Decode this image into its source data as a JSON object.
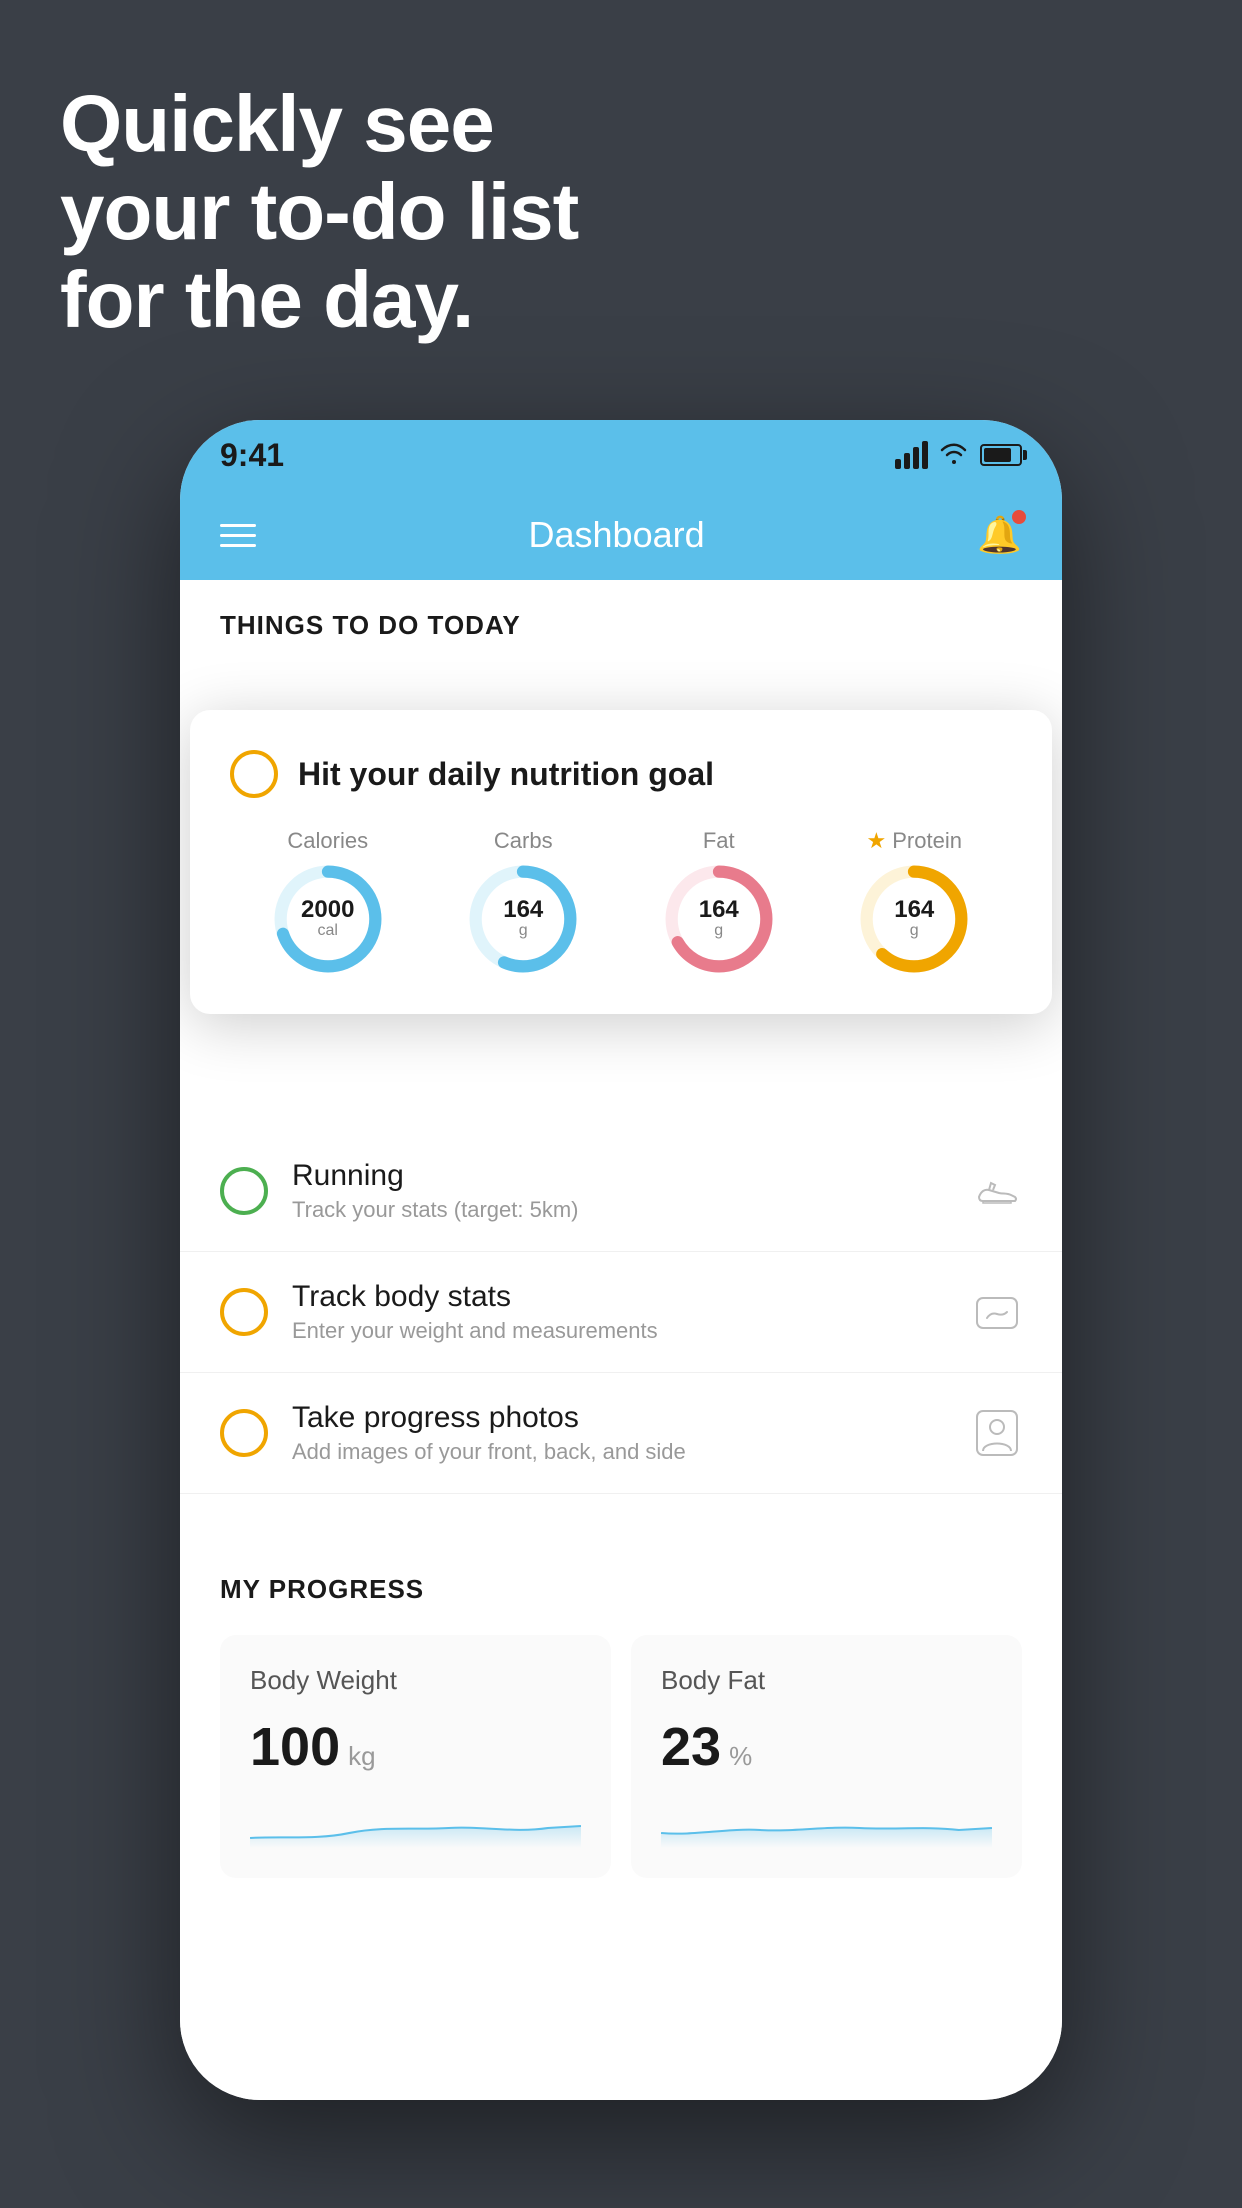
{
  "headline": {
    "line1": "Quickly see",
    "line2": "your to-do list",
    "line3": "for the day."
  },
  "status_bar": {
    "time": "9:41",
    "signal_bars": 4,
    "battery_pct": 80
  },
  "header": {
    "title": "Dashboard"
  },
  "things_section": {
    "title": "THINGS TO DO TODAY"
  },
  "floating_card": {
    "circle_color": "yellow",
    "title": "Hit your daily nutrition goal",
    "items": [
      {
        "label": "Calories",
        "value": "2000",
        "unit": "cal",
        "color": "#5bbfea",
        "track_color": "#e0f4fb",
        "pct": 70
      },
      {
        "label": "Carbs",
        "value": "164",
        "unit": "g",
        "color": "#5bbfea",
        "track_color": "#e0f4fb",
        "pct": 55
      },
      {
        "label": "Fat",
        "value": "164",
        "unit": "g",
        "color": "#e87b8c",
        "track_color": "#fce8ec",
        "pct": 65
      },
      {
        "label": "Protein",
        "value": "164",
        "unit": "g",
        "color": "#f0a500",
        "track_color": "#fdf3d8",
        "pct": 60,
        "star": true
      }
    ]
  },
  "todo_items": [
    {
      "id": "running",
      "circle_color": "green",
      "title": "Running",
      "subtitle": "Track your stats (target: 5km)",
      "icon": "shoe"
    },
    {
      "id": "body-stats",
      "circle_color": "yellow",
      "title": "Track body stats",
      "subtitle": "Enter your weight and measurements",
      "icon": "scale"
    },
    {
      "id": "photos",
      "circle_color": "yellow",
      "title": "Take progress photos",
      "subtitle": "Add images of your front, back, and side",
      "icon": "person"
    }
  ],
  "progress_section": {
    "title": "MY PROGRESS",
    "cards": [
      {
        "id": "body-weight",
        "title": "Body Weight",
        "value": "100",
        "unit": "kg",
        "chart_color": "#5bbfea"
      },
      {
        "id": "body-fat",
        "title": "Body Fat",
        "value": "23",
        "unit": "%",
        "chart_color": "#5bbfea"
      }
    ]
  }
}
